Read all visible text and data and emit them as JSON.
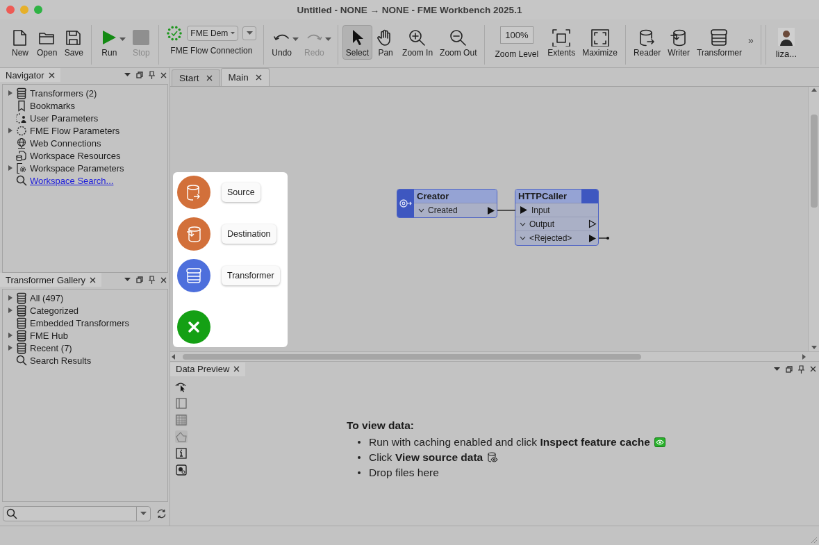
{
  "window": {
    "title": "Untitled - NONE → NONE - FME Workbench 2025.1"
  },
  "toolbar": {
    "groups": [
      [
        {
          "kind": "button",
          "label": "New",
          "disabled": false,
          "dropdown": false
        },
        {
          "kind": "button",
          "label": "Open",
          "disabled": false,
          "dropdown": false
        },
        {
          "kind": "button",
          "label": "Save",
          "disabled": false,
          "dropdown": false
        }
      ],
      [
        {
          "kind": "button",
          "label": "Run",
          "disabled": false,
          "dropdown": true
        },
        {
          "kind": "button",
          "label": "Stop",
          "disabled": true,
          "dropdown": false
        }
      ],
      [
        {
          "kind": "connection",
          "label": "FME Flow Connection",
          "value": "FME Dem"
        }
      ],
      [
        {
          "kind": "button",
          "label": "Undo",
          "disabled": false,
          "dropdown": true
        },
        {
          "kind": "button",
          "label": "Redo",
          "disabled": true,
          "dropdown": true
        }
      ],
      [
        {
          "kind": "button",
          "label": "Select",
          "disabled": false,
          "dropdown": false,
          "selected": true
        },
        {
          "kind": "button",
          "label": "Pan",
          "disabled": false,
          "dropdown": false,
          "selected": false
        },
        {
          "kind": "button",
          "label": "Zoom In",
          "disabled": false,
          "dropdown": false,
          "selected": false
        },
        {
          "kind": "button",
          "label": "Zoom Out",
          "disabled": false,
          "dropdown": false,
          "selected": false
        }
      ],
      [
        {
          "kind": "zoom",
          "label": "Zoom Level",
          "value": "100%"
        },
        {
          "kind": "button",
          "label": "Extents",
          "disabled": false,
          "dropdown": false
        },
        {
          "kind": "button",
          "label": "Maximize",
          "disabled": false,
          "dropdown": false
        }
      ],
      [
        {
          "kind": "button",
          "label": "Reader",
          "disabled": false,
          "dropdown": false
        },
        {
          "kind": "button",
          "label": "Writer",
          "disabled": false,
          "dropdown": false
        },
        {
          "kind": "button",
          "label": "Transformer",
          "disabled": false,
          "dropdown": false
        },
        {
          "kind": "overflow",
          "label": "»"
        }
      ],
      [
        {
          "kind": "user",
          "label": "liza..."
        }
      ]
    ]
  },
  "navigator": {
    "title": "Navigator",
    "items": [
      {
        "label": "Transformers (2)",
        "expandable": true
      },
      {
        "label": "Bookmarks",
        "expandable": false
      },
      {
        "label": "User Parameters",
        "expandable": false
      },
      {
        "label": "FME Flow Parameters",
        "expandable": true
      },
      {
        "label": "Web Connections",
        "expandable": false
      },
      {
        "label": "Workspace Resources",
        "expandable": false
      },
      {
        "label": "Workspace Parameters",
        "expandable": true
      },
      {
        "label": "Workspace Search...",
        "expandable": false,
        "kind": "link"
      }
    ]
  },
  "gallery": {
    "title": "Transformer Gallery",
    "items": [
      {
        "label": "All (497)",
        "expandable": true
      },
      {
        "label": "Categorized",
        "expandable": true
      },
      {
        "label": "Embedded Transformers",
        "expandable": false
      },
      {
        "label": "FME Hub",
        "expandable": true
      },
      {
        "label": "Recent (7)",
        "expandable": true
      },
      {
        "label": "Search Results",
        "expandable": false
      }
    ]
  },
  "tabs": [
    {
      "label": "Start",
      "selected": false
    },
    {
      "label": "Main",
      "selected": true
    }
  ],
  "canvas": {
    "nodes": [
      {
        "kind": "creator",
        "title": "Creator",
        "ports": [
          {
            "kind": "output",
            "label": "Created",
            "connected": true
          }
        ]
      },
      {
        "kind": "transformer",
        "title": "HTTPCaller",
        "ports": [
          {
            "kind": "input",
            "label": "Input",
            "connected": true
          },
          {
            "kind": "output",
            "label": "Output",
            "connected": false
          },
          {
            "kind": "output",
            "label": "<Rejected>",
            "connected": true
          }
        ]
      }
    ],
    "quick_add": [
      {
        "label": "Source",
        "color": "#d2703a"
      },
      {
        "label": "Destination",
        "color": "#d2703a"
      },
      {
        "label": "Transformer",
        "color": "#4d6fdc"
      }
    ]
  },
  "data_preview": {
    "title": "Data Preview",
    "heading": "To view data:",
    "lines": [
      "Run with caching enabled and click **Inspect feature cache**",
      "Click **View source data**",
      "Drop files here"
    ]
  }
}
